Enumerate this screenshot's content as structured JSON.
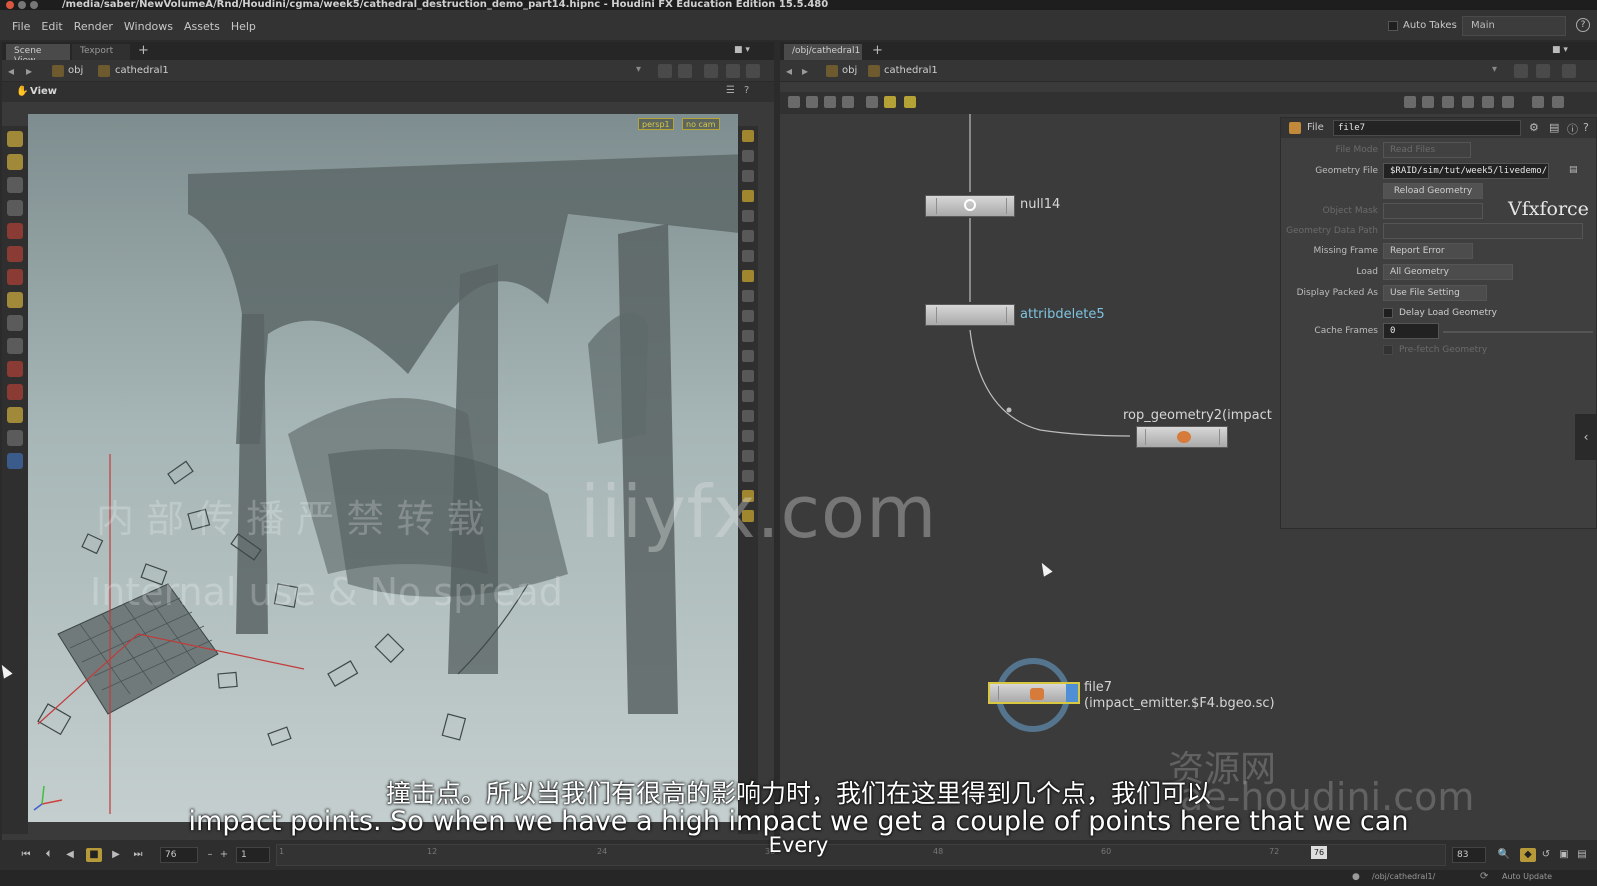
{
  "window": {
    "title": "/media/saber/NewVolumeA/Rnd/Houdini/cgma/week5/cathedral_destruction_demo_part14.hipnc - Houdini FX Education Edition 15.5.480"
  },
  "menubar": {
    "items": [
      "File",
      "Edit",
      "Render",
      "Windows",
      "Assets",
      "Help"
    ],
    "auto_takes_label": "Auto Takes",
    "take_value": "Main"
  },
  "left_pane": {
    "tabs": [
      "Scene View",
      "Texport"
    ],
    "path": {
      "root": "obj",
      "node": "cathedral1"
    },
    "view_label": "View",
    "viewport_badges": [
      "persp1",
      "no cam"
    ]
  },
  "right_pane": {
    "tabs": [
      "/obj/cathedral1"
    ],
    "path": {
      "root": "obj",
      "node": "cathedral1"
    }
  },
  "network": {
    "nodes": [
      {
        "name": "null14"
      },
      {
        "name": "attribdelete5"
      },
      {
        "name": "rop_geometry2(impact"
      },
      {
        "name": "file7",
        "subtitle": "(impact_emitter.$F4.bgeo.sc)"
      }
    ]
  },
  "params": {
    "type_label": "File",
    "node_name": "file7",
    "rows": [
      {
        "label": "File Mode",
        "value": "Read Files",
        "dim": true
      },
      {
        "label": "Geometry File",
        "value": "$RAID/sim/tut/week5/livedemo/",
        "field": true
      },
      {
        "label": "",
        "value": "Reload Geometry",
        "button": true
      },
      {
        "label": "Object Mask",
        "value": "",
        "dim": true
      },
      {
        "label": "Geometry Data Path",
        "value": "",
        "dim": true
      },
      {
        "label": "Missing Frame",
        "value": "Report Error"
      },
      {
        "label": "Load",
        "value": "All Geometry"
      },
      {
        "label": "Display Packed As",
        "value": "Use File Setting"
      },
      {
        "label": "",
        "value": "Delay Load Geometry",
        "checkbox": true
      },
      {
        "label": "Cache Frames",
        "value": "0",
        "field": true
      },
      {
        "label": "",
        "value": "Pre-fetch Geometry",
        "checkbox": true,
        "dim": true
      }
    ]
  },
  "timeline": {
    "current_frame": "76",
    "start_frame": "1",
    "end_frame": "83",
    "ticks": [
      "1",
      "12",
      "24",
      "36",
      "48",
      "60",
      "72"
    ],
    "marker": "76"
  },
  "statusbar": {
    "path": "/obj/cathedral1/",
    "auto_update": "Auto Update"
  },
  "overlays": {
    "watermark": "iiiyfx.com",
    "cn_watermark_1": "内 部 传 播 严 禁 转 载",
    "cn_watermark_2": "Internal use & No spread",
    "zy_watermark": "资源网",
    "hd_watermark": "ae-houdini.com",
    "vfx_logo": "Vfxforce",
    "subtitle_cn": "撞击点。所以当我们有很高的影响力时，我们在这里得到几个点，我们可以",
    "subtitle_en": "impact points. So when we have a high impact we get a couple of points here that we can",
    "subtitle_en_2": "Every"
  }
}
